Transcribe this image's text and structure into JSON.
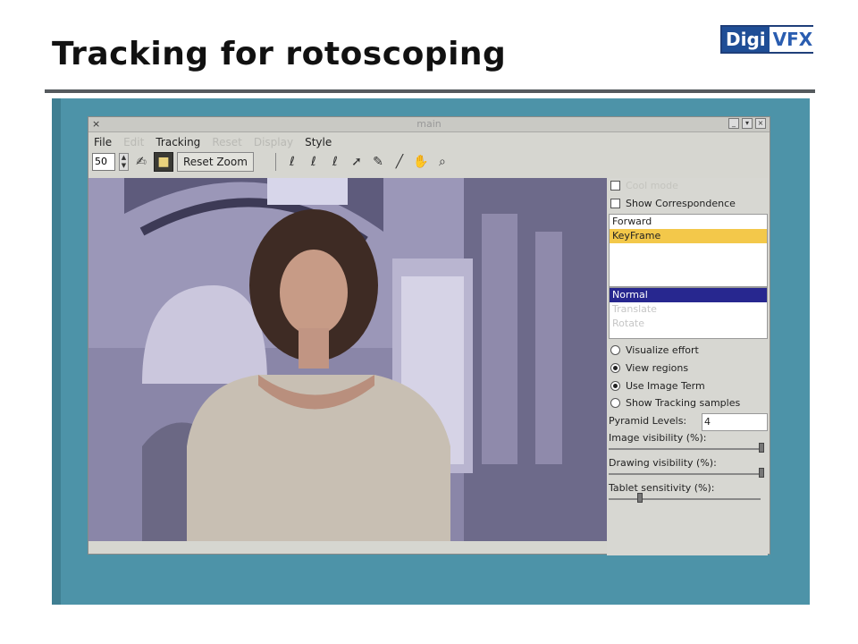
{
  "slide": {
    "title": "Tracking for rotoscoping",
    "logo_left": "Digi",
    "logo_right": "VFX"
  },
  "window": {
    "title": "main",
    "close_glyph": "×",
    "menu": [
      "File",
      "Edit",
      "Tracking",
      "Reset",
      "Display",
      "Style"
    ],
    "menu_dim": [
      false,
      true,
      false,
      true,
      true,
      false
    ]
  },
  "toolbar": {
    "zoom_value": "50",
    "reset_zoom_label": "Reset Zoom"
  },
  "panel": {
    "top_dim_option": "Cool mode",
    "show_correspondence": "Show Correspondence",
    "direction_list": [
      "Forward",
      "KeyFrame"
    ],
    "mode_list": [
      "Normal",
      "Translate",
      "Rotate"
    ],
    "radios": [
      {
        "label": "Visualize effort",
        "checked": false
      },
      {
        "label": "View regions",
        "checked": true
      },
      {
        "label": "Use Image Term",
        "checked": true
      },
      {
        "label": "Show Tracking samples",
        "checked": false
      }
    ],
    "pyramid_label": "Pyramid Levels:",
    "pyramid_value": "4",
    "image_visibility": "Image visibility (%):",
    "drawing_visibility": "Drawing visibility (%):",
    "tablet_sensitivity": "Tablet sensitivity (%):"
  },
  "sliders": {
    "image_visibility_level": 1.0,
    "drawing_visibility_level": 1.0,
    "tablet_sensitivity_level": 0.2
  },
  "colors": {
    "keyframe_highlight": "#f3c84a",
    "normal_highlight": "#27278f",
    "video_background": "#4d93a8"
  }
}
